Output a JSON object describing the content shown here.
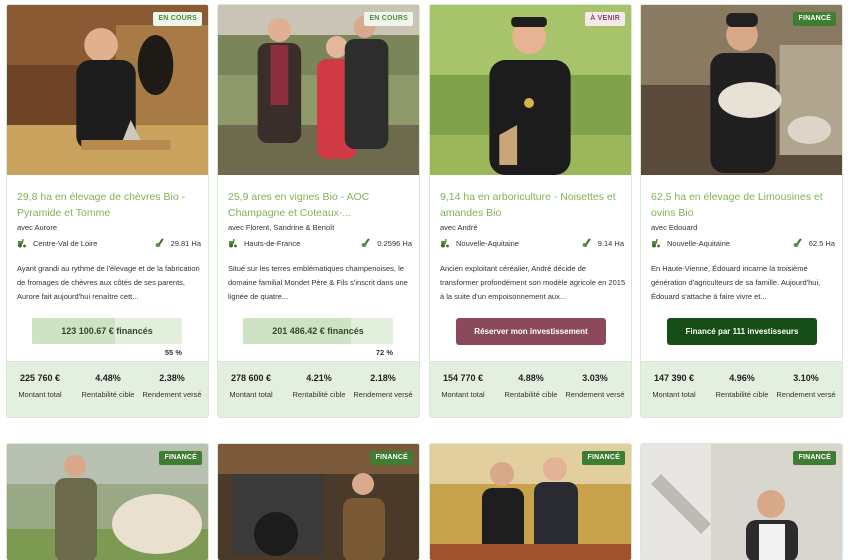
{
  "cards": [
    {
      "status": "EN COURS",
      "title": "29,8 ha en élevage de chèvres Bio - Pyramide et Tomme",
      "owner": "avec Aurore",
      "region": "Centre-Val de Loire",
      "area": "29.81 Ha",
      "description": "Ayant grandi au rythme de l'élevage et de la fabrication de fromages de chèvres aux côtés de ses parents, Aurore fait aujourd'hui renaître cett...",
      "progress_text": "123 100.67 € financés",
      "progress_fraction": 0.55,
      "percent": "55 %",
      "amount": "225 760 €",
      "amount_label": "Montant total",
      "rentab": "4.48%",
      "rentab_label": "Rentabilité cible",
      "rendement": "2.38%",
      "rendement_label": "Rendement versé"
    },
    {
      "status": "EN COURS",
      "title": "25,9 ares en vignes Bio - AOC Champagne et Coteaux-...",
      "owner": "avec Florent, Sandrine & Benoît",
      "region": "Hauts-de-France",
      "area": "0.2596 Ha",
      "description": "Situé sur les terres emblématiques champenoises, le domaine familial Mondet Père & Fils s'inscrit dans une lignée de quatre...",
      "progress_text": "201 486.42 € financés",
      "progress_fraction": 0.72,
      "percent": "72 %",
      "amount": "278 600 €",
      "amount_label": "Montant total",
      "rentab": "4.21%",
      "rentab_label": "Rentabilité cible",
      "rendement": "2.18%",
      "rendement_label": "Rendement versé"
    },
    {
      "status": "À VENIR",
      "title": "9,14 ha en arboriculture - Noisettes et amandes Bio",
      "owner": "avec André",
      "region": "Nouvelle-Aquitaine",
      "area": "9.14 Ha",
      "description": "Ancien exploitant céréalier, André décide de transformer profondément son modèle agricole en 2015 à la suite d'un empoisonnement aux...",
      "button": "Réserver mon investissement",
      "amount": "154 770 €",
      "amount_label": "Montant total",
      "rentab": "4.88%",
      "rentab_label": "Rentabilité cible",
      "rendement": "3.03%",
      "rendement_label": "Rendement versé"
    },
    {
      "status": "FINANCÉ",
      "title": "62,5 ha en élevage de Limousines et ovins Bio",
      "owner": "avec Edouard",
      "region": "Nouvelle-Aquitaine",
      "area": "62.5 Ha",
      "description": "En Haute-Vienne, Édouard incarne la troisième génération d'agriculteurs de sa famille. Aujourd'hui, Édouard s'attache à faire vivre et...",
      "button": "Financé par 111 investisseurs",
      "amount": "147 390 €",
      "amount_label": "Montant total",
      "rentab": "4.96%",
      "rentab_label": "Rentabilité cible",
      "rendement": "3.10%",
      "rendement_label": "Rendement versé"
    }
  ],
  "row2": [
    {
      "status": "FINANCÉ"
    },
    {
      "status": "FINANCÉ"
    },
    {
      "status": "FINANCÉ"
    },
    {
      "status": "FINANCÉ"
    }
  ],
  "colors": {
    "accent_green": "#7fb257",
    "stats_bg": "#e3f0df",
    "reserve_button": "#8b4a5c",
    "funded_button": "#174e17"
  },
  "icons": {
    "region": "tractor-icon",
    "area": "shovel-icon"
  }
}
